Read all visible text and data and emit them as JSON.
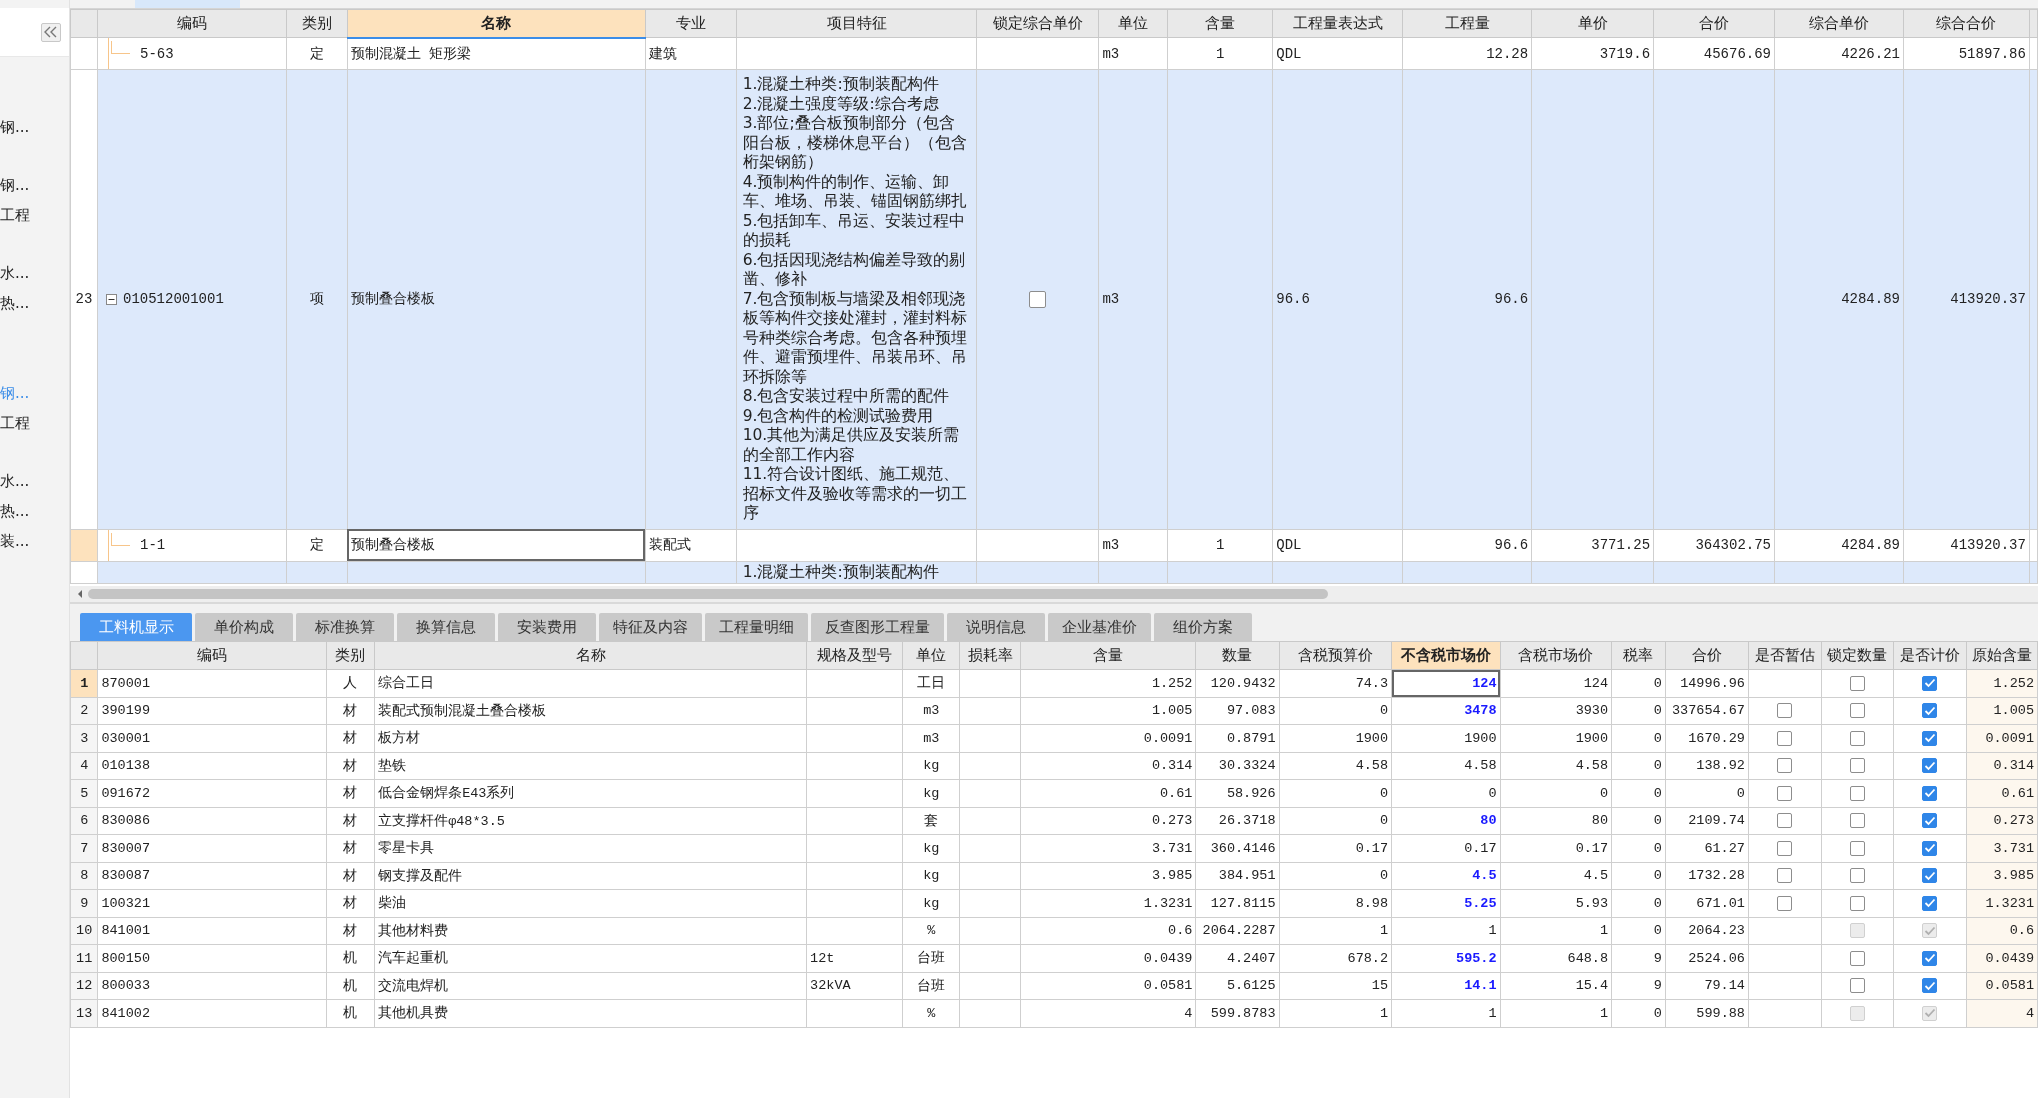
{
  "sidebar": {
    "items": [
      {
        "label": "钢...",
        "selected": false
      },
      {
        "label": "钢...",
        "selected": false
      },
      {
        "label": "工程",
        "selected": false
      },
      {
        "label": "水...",
        "selected": false
      },
      {
        "label": "热...",
        "selected": false
      },
      {
        "label": "钢...",
        "selected": true
      },
      {
        "label": "工程",
        "selected": false
      },
      {
        "label": "水...",
        "selected": false
      },
      {
        "label": "热...",
        "selected": false
      },
      {
        "label": "装...",
        "selected": false
      }
    ]
  },
  "bill_table": {
    "columns": [
      {
        "label": "编码",
        "selected": false
      },
      {
        "label": "类别",
        "selected": false
      },
      {
        "label": "名称",
        "selected": true
      },
      {
        "label": "专业",
        "selected": false
      },
      {
        "label": "项目特征",
        "selected": false
      },
      {
        "label": "锁定综合单价",
        "selected": false
      },
      {
        "label": "单位",
        "selected": false
      },
      {
        "label": "含量",
        "selected": false
      },
      {
        "label": "工程量表达式",
        "selected": false
      },
      {
        "label": "工程量",
        "selected": false
      },
      {
        "label": "单价",
        "selected": false
      },
      {
        "label": "合价",
        "selected": false
      },
      {
        "label": "综合单价",
        "selected": false
      },
      {
        "label": "综合合价",
        "selected": false
      }
    ],
    "rows": [
      {
        "kind": "quota",
        "selected": false,
        "code": "5-63",
        "type": "定",
        "name": "预制混凝土 矩形梁",
        "major": "建筑",
        "unit": "m3",
        "content": "1",
        "expr": "QDL",
        "qty": "12.28",
        "price": "3719.6",
        "total": "45676.69",
        "comp_price": "4226.21",
        "comp_total": "51897.86"
      },
      {
        "kind": "item",
        "selected": false,
        "expanded": true,
        "no": "23",
        "code": "010512001001",
        "type": "项",
        "name": "预制叠合楼板",
        "features": [
          "1.混凝土种类:预制装配构件",
          "2.混凝土强度等级:综合考虑",
          "3.部位;叠合板预制部分（包含阳台板，楼梯休息平台）（包含桁架钢筋）",
          "4.预制构件的制作、运输、卸车、堆场、吊装、锚固钢筋绑扎",
          "5.包括卸车、吊运、安装过程中的损耗",
          "6.包括因现浇结构偏差导致的剔凿、修补",
          "7.包含预制板与墙梁及相邻现浇板等构件交接处灌封，灌封料标号种类综合考虑。包含各种预埋件、避雷预埋件、吊装吊环、吊环拆除等",
          "8.包含安装过程中所需的配件",
          "9.包含构件的检测试验费用",
          "10.其他为满足供应及安装所需的全部工作内容",
          "11.符合设计图纸、施工规范、招标文件及验收等需求的一切工序"
        ],
        "lock": {
          "checked": false
        },
        "unit": "m3",
        "expr": "96.6",
        "qty": "96.6",
        "comp_price": "4284.89",
        "comp_total": "413920.37"
      },
      {
        "kind": "quota",
        "selected": true,
        "code": "1-1",
        "type": "定",
        "name": "预制叠合楼板",
        "major": "装配式",
        "unit": "m3",
        "content": "1",
        "expr": "QDL",
        "qty": "96.6",
        "price": "3771.25",
        "total": "364302.75",
        "comp_price": "4284.89",
        "comp_total": "413920.37"
      },
      {
        "kind": "item",
        "selected": false,
        "features": [
          "1.混凝土种类:预制装配构件"
        ]
      }
    ]
  },
  "detail_tabs": [
    {
      "label": "工料机显示",
      "selected": true
    },
    {
      "label": "单价构成",
      "selected": false
    },
    {
      "label": "标准换算",
      "selected": false
    },
    {
      "label": "换算信息",
      "selected": false
    },
    {
      "label": "安装费用",
      "selected": false
    },
    {
      "label": "特征及内容",
      "selected": false
    },
    {
      "label": "工程量明细",
      "selected": false
    },
    {
      "label": "反查图形工程量",
      "selected": false
    },
    {
      "label": "说明信息",
      "selected": false
    },
    {
      "label": "企业基准价",
      "selected": false
    },
    {
      "label": "组价方案",
      "selected": false
    }
  ],
  "resource_table": {
    "columns": [
      {
        "label": "编码",
        "selected": false
      },
      {
        "label": "类别",
        "selected": false
      },
      {
        "label": "名称",
        "selected": false
      },
      {
        "label": "规格及型号",
        "selected": false
      },
      {
        "label": "单位",
        "selected": false
      },
      {
        "label": "损耗率",
        "selected": false
      },
      {
        "label": "含量",
        "selected": false
      },
      {
        "label": "数量",
        "selected": false
      },
      {
        "label": "含税预算价",
        "selected": false
      },
      {
        "label": "不含税市场价",
        "selected": true
      },
      {
        "label": "含税市场价",
        "selected": false
      },
      {
        "label": "税率",
        "selected": false
      },
      {
        "label": "合价",
        "selected": false
      },
      {
        "label": "是否暂估",
        "selected": false
      },
      {
        "label": "锁定数量",
        "selected": false
      },
      {
        "label": "是否计价",
        "selected": false
      },
      {
        "label": "原始含量",
        "selected": false
      }
    ],
    "rows": [
      {
        "no": "1",
        "selected": true,
        "code": "870001",
        "type": "人",
        "name": "综合工日",
        "unit": "工日",
        "content": "1.252",
        "qty": "120.9432",
        "tax_budget": "74.3",
        "market": "124",
        "adjusted": true,
        "tax_market": "124",
        "rate": "0",
        "total": "14996.96",
        "lock_qty": {
          "checked": false,
          "disabled": false
        },
        "priced": {
          "checked": true,
          "disabled": false
        },
        "original": "1.252"
      },
      {
        "no": "2",
        "selected": false,
        "code": "390199",
        "type": "材",
        "name": "装配式预制混凝土叠合楼板",
        "unit": "m3",
        "content": "1.005",
        "qty": "97.083",
        "tax_budget": "0",
        "market": "3478",
        "adjusted": true,
        "tax_market": "3930",
        "rate": "0",
        "total": "337654.67",
        "estimate": {
          "checked": false,
          "disabled": false
        },
        "lock_qty": {
          "checked": false,
          "disabled": false
        },
        "priced": {
          "checked": true,
          "disabled": false
        },
        "original": "1.005"
      },
      {
        "no": "3",
        "selected": false,
        "code": "030001",
        "type": "材",
        "name": "板方材",
        "unit": "m3",
        "content": "0.0091",
        "qty": "0.8791",
        "tax_budget": "1900",
        "market": "1900",
        "adjusted": false,
        "tax_market": "1900",
        "rate": "0",
        "total": "1670.29",
        "estimate": {
          "checked": false,
          "disabled": false
        },
        "lock_qty": {
          "checked": false,
          "disabled": false
        },
        "priced": {
          "checked": true,
          "disabled": false
        },
        "original": "0.0091"
      },
      {
        "no": "4",
        "selected": false,
        "code": "010138",
        "type": "材",
        "name": "垫铁",
        "unit": "kg",
        "content": "0.314",
        "qty": "30.3324",
        "tax_budget": "4.58",
        "market": "4.58",
        "adjusted": false,
        "tax_market": "4.58",
        "rate": "0",
        "total": "138.92",
        "estimate": {
          "checked": false,
          "disabled": false
        },
        "lock_qty": {
          "checked": false,
          "disabled": false
        },
        "priced": {
          "checked": true,
          "disabled": false
        },
        "original": "0.314"
      },
      {
        "no": "5",
        "selected": false,
        "code": "091672",
        "type": "材",
        "name": "低合金钢焊条E43系列",
        "unit": "kg",
        "content": "0.61",
        "qty": "58.926",
        "tax_budget": "0",
        "market": "0",
        "adjusted": false,
        "tax_market": "0",
        "rate": "0",
        "total": "0",
        "estimate": {
          "checked": false,
          "disabled": false
        },
        "lock_qty": {
          "checked": false,
          "disabled": false
        },
        "priced": {
          "checked": true,
          "disabled": false
        },
        "original": "0.61"
      },
      {
        "no": "6",
        "selected": false,
        "code": "830086",
        "type": "材",
        "name": "立支撑杆件φ48*3.5",
        "unit": "套",
        "content": "0.273",
        "qty": "26.3718",
        "tax_budget": "0",
        "market": "80",
        "adjusted": true,
        "tax_market": "80",
        "rate": "0",
        "total": "2109.74",
        "estimate": {
          "checked": false,
          "disabled": false
        },
        "lock_qty": {
          "checked": false,
          "disabled": false
        },
        "priced": {
          "checked": true,
          "disabled": false
        },
        "original": "0.273"
      },
      {
        "no": "7",
        "selected": false,
        "code": "830007",
        "type": "材",
        "name": "零星卡具",
        "unit": "kg",
        "content": "3.731",
        "qty": "360.4146",
        "tax_budget": "0.17",
        "market": "0.17",
        "adjusted": false,
        "tax_market": "0.17",
        "rate": "0",
        "total": "61.27",
        "estimate": {
          "checked": false,
          "disabled": false
        },
        "lock_qty": {
          "checked": false,
          "disabled": false
        },
        "priced": {
          "checked": true,
          "disabled": false
        },
        "original": "3.731"
      },
      {
        "no": "8",
        "selected": false,
        "code": "830087",
        "type": "材",
        "name": "钢支撑及配件",
        "unit": "kg",
        "content": "3.985",
        "qty": "384.951",
        "tax_budget": "0",
        "market": "4.5",
        "adjusted": true,
        "tax_market": "4.5",
        "rate": "0",
        "total": "1732.28",
        "estimate": {
          "checked": false,
          "disabled": false
        },
        "lock_qty": {
          "checked": false,
          "disabled": false
        },
        "priced": {
          "checked": true,
          "disabled": false
        },
        "original": "3.985"
      },
      {
        "no": "9",
        "selected": false,
        "code": "100321",
        "type": "材",
        "name": "柴油",
        "unit": "kg",
        "content": "1.3231",
        "qty": "127.8115",
        "tax_budget": "8.98",
        "market": "5.25",
        "adjusted": true,
        "tax_market": "5.93",
        "rate": "0",
        "total": "671.01",
        "estimate": {
          "checked": false,
          "disabled": false
        },
        "lock_qty": {
          "checked": false,
          "disabled": false
        },
        "priced": {
          "checked": true,
          "disabled": false
        },
        "original": "1.3231"
      },
      {
        "no": "10",
        "selected": false,
        "code": "841001",
        "type": "材",
        "name": "其他材料费",
        "unit": "%",
        "content": "0.6",
        "qty": "2064.2287",
        "tax_budget": "1",
        "market": "1",
        "adjusted": false,
        "tax_market": "1",
        "rate": "0",
        "total": "2064.23",
        "lock_qty": {
          "checked": false,
          "disabled": true
        },
        "priced": {
          "checked": true,
          "disabled": true
        },
        "original": "0.6"
      },
      {
        "no": "11",
        "selected": false,
        "code": "800150",
        "type": "机",
        "name": "汽车起重机",
        "spec": "12t",
        "unit": "台班",
        "content": "0.0439",
        "qty": "4.2407",
        "tax_budget": "678.2",
        "market": "595.2",
        "adjusted": true,
        "tax_market": "648.8",
        "rate": "9",
        "total": "2524.06",
        "lock_qty": {
          "checked": false,
          "disabled": false
        },
        "priced": {
          "checked": true,
          "disabled": false
        },
        "original": "0.0439"
      },
      {
        "no": "12",
        "selected": false,
        "code": "800033",
        "type": "机",
        "name": "交流电焊机",
        "spec": "32kVA",
        "unit": "台班",
        "content": "0.0581",
        "qty": "5.6125",
        "tax_budget": "15",
        "market": "14.1",
        "adjusted": true,
        "tax_market": "15.4",
        "rate": "9",
        "total": "79.14",
        "lock_qty": {
          "checked": false,
          "disabled": false
        },
        "priced": {
          "checked": true,
          "disabled": false
        },
        "original": "0.0581"
      },
      {
        "no": "13",
        "selected": false,
        "code": "841002",
        "type": "机",
        "name": "其他机具费",
        "unit": "%",
        "content": "4",
        "qty": "599.8783",
        "tax_budget": "1",
        "market": "1",
        "adjusted": false,
        "tax_market": "1",
        "rate": "0",
        "total": "599.88",
        "lock_qty": {
          "checked": false,
          "disabled": true
        },
        "priced": {
          "checked": true,
          "disabled": true
        },
        "original": "4"
      }
    ]
  }
}
